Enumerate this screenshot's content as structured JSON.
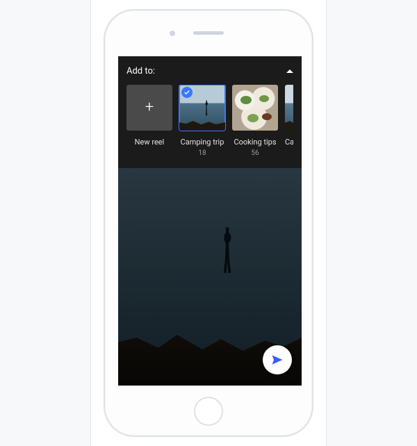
{
  "panel": {
    "title": "Add to:",
    "reels": [
      {
        "label": "New reel",
        "count": ""
      },
      {
        "label": "Camping trip",
        "count": "18"
      },
      {
        "label": "Cooking tips",
        "count": "56"
      },
      {
        "label": "Came",
        "count": ""
      }
    ]
  },
  "icons": {
    "plus": "+",
    "send": "send-icon",
    "check": "check-icon",
    "collapse": "caret-up-icon"
  },
  "colors": {
    "accent": "#3b78ff",
    "panel_bg": "#1b1b1b"
  }
}
